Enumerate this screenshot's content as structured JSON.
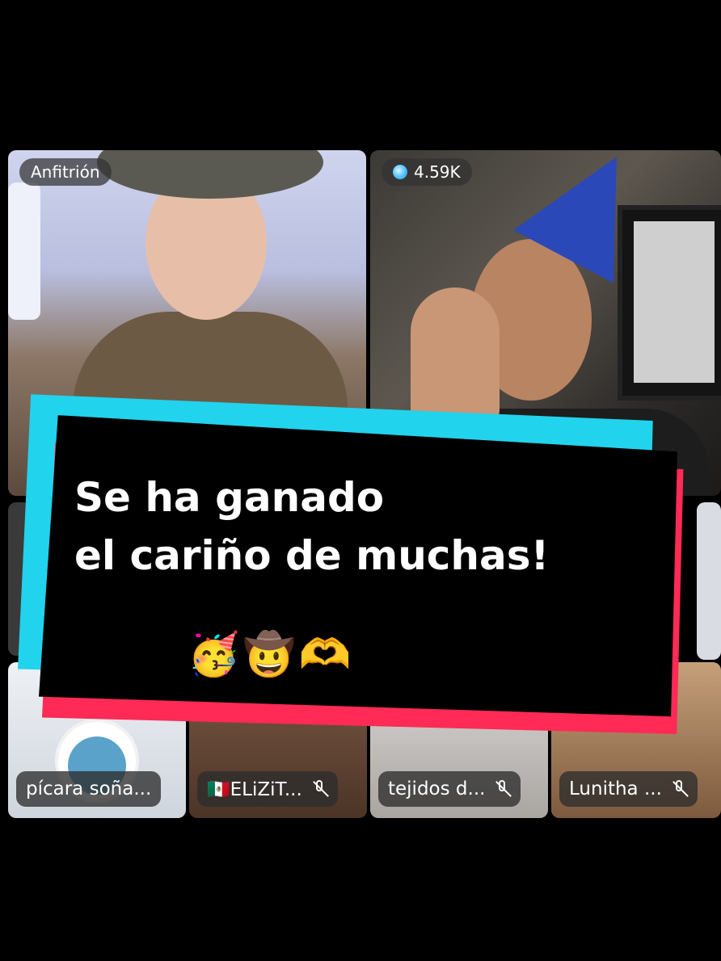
{
  "host_tile": {
    "label": "Anfitrión"
  },
  "guest_tile": {
    "viewer_count": "4.59K",
    "icon": "gem-icon"
  },
  "participants": [
    {
      "name": "pícara soña...",
      "muted": false
    },
    {
      "name": "🇲🇽ELiZiT...",
      "muted": true
    },
    {
      "name": "tejidos d...",
      "muted": true
    },
    {
      "name": "Lunitha ...",
      "muted": true
    }
  ],
  "banner": {
    "line1": "Se ha ganado",
    "line2": "el cariño de muchas!",
    "emojis": "🥳🤠🫶",
    "colors": {
      "cyan": "#21d3ec",
      "red": "#ff2a55",
      "fill": "#000000"
    }
  }
}
